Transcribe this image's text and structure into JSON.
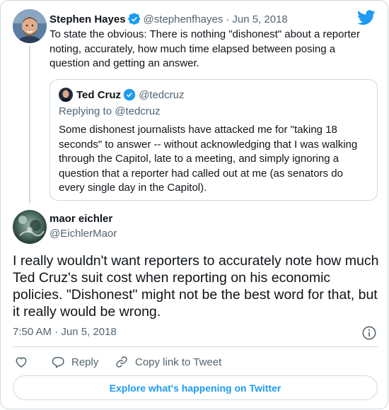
{
  "parent_tweet": {
    "author_name": "Stephen Hayes",
    "handle": "@stephenfhayes",
    "separator": "·",
    "date": "Jun 5, 2018",
    "text": "To state the obvious: There is nothing \"dishonest\" about a reporter noting, accurately, how much time elapsed between posing a question and getting an answer.",
    "verified": true
  },
  "quoted_tweet": {
    "author_name": "Ted Cruz",
    "handle": "@tedcruz",
    "replying_to": "Replying to @tedcruz",
    "text": "Some dishonest journalists have attacked me for \"taking 18 seconds\" to answer -- without acknowledging that I was walking through the Capitol, late to a meeting, and simply ignoring a question that a reporter had called out at me (as senators do every single day in the Capitol).",
    "verified": true
  },
  "main_tweet": {
    "author_name": "maor eichler",
    "handle": "@EichlerMaor",
    "text": "I really wouldn't want reporters to accurately note how much Ted Cruz's suit cost when reporting on his economic policies. \"Dishonest\" might not be the best word for that, but it really would be wrong.",
    "timestamp": "7:50 AM · Jun 5, 2018"
  },
  "actions": {
    "like_icon": "heart-icon",
    "reply_label": "Reply",
    "copy_label": "Copy link to Tweet"
  },
  "explore_label": "Explore what's happening on Twitter",
  "colors": {
    "accent": "#1d9bf0",
    "text": "#0f1419",
    "muted": "#536471",
    "border": "#cfd9de"
  }
}
